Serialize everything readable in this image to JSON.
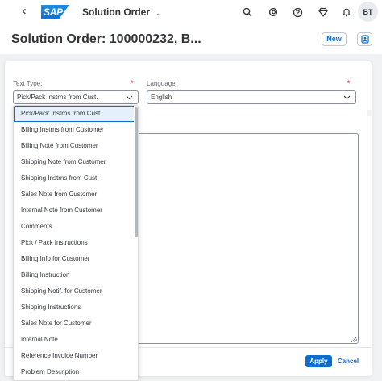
{
  "shell": {
    "back_glyph": "‹",
    "logo_text": "SAP",
    "app_title": "Solution Order",
    "title_chevron": "⌄",
    "avatar_initials": "BT"
  },
  "header": {
    "object_title": "Solution Order: 100000232, B...",
    "new_label": "New"
  },
  "dialog": {
    "text_type_label": "Text Type:",
    "language_label": "Language:",
    "required_marker": "*",
    "text_type_value": "Pick/Pack Instrns from Cust.",
    "language_value": "English",
    "apply_label": "Apply",
    "cancel_label": "Cancel"
  },
  "dropdown": {
    "items": [
      "Pick/Pack Instrns from Cust.",
      "Billing Instrns from Customer",
      "Billing Note from Customer",
      "Shipping Note from Customer",
      "Shipping Instrns from Cust.",
      "Sales Note from Customer",
      "Internal Note from Customer",
      "Comments",
      "Pick / Pack Instructions",
      "Billing Info for Customer",
      "Billing Instruction",
      "Shipping Notif. for Customer",
      "Shipping Instructions",
      "Sales Note for Customer",
      "Internal Note",
      "Reference Invoice Number",
      "Problem Description"
    ],
    "selected_index": 0
  },
  "colors": {
    "accent": "#0a6ed1",
    "required": "#bb0000",
    "text": "#32363a"
  }
}
